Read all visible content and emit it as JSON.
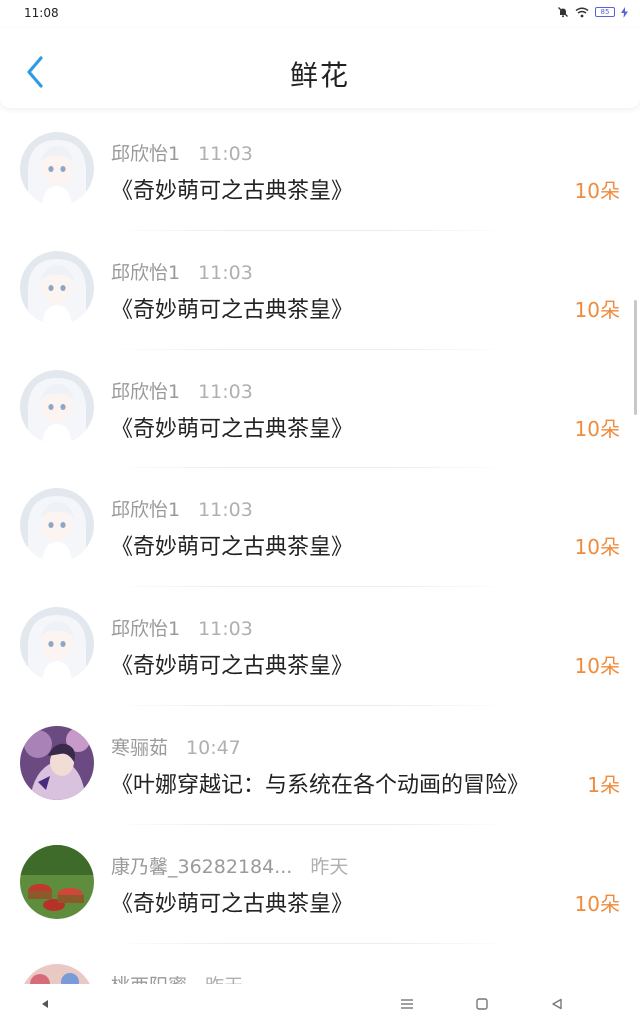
{
  "status_bar": {
    "time": "11:08",
    "battery": "85"
  },
  "header": {
    "title": "鲜花"
  },
  "colors": {
    "accent_blue": "#2f9ae6",
    "flower_amount": "#f08a3c"
  },
  "list": {
    "items": [
      {
        "user": "邱欣怡1",
        "time": "11:03",
        "book": "《奇妙萌可之古典茶皇》",
        "amount": "10朵",
        "avatar": "white-hair-girl-avatar"
      },
      {
        "user": "邱欣怡1",
        "time": "11:03",
        "book": "《奇妙萌可之古典茶皇》",
        "amount": "10朵",
        "avatar": "white-hair-girl-avatar"
      },
      {
        "user": "邱欣怡1",
        "time": "11:03",
        "book": "《奇妙萌可之古典茶皇》",
        "amount": "10朵",
        "avatar": "white-hair-girl-avatar"
      },
      {
        "user": "邱欣怡1",
        "time": "11:03",
        "book": "《奇妙萌可之古典茶皇》",
        "amount": "10朵",
        "avatar": "white-hair-girl-avatar"
      },
      {
        "user": "邱欣怡1",
        "time": "11:03",
        "book": "《奇妙萌可之古典茶皇》",
        "amount": "10朵",
        "avatar": "white-hair-girl-avatar"
      },
      {
        "user": "寒骊茹",
        "time": "10:47",
        "book": "《叶娜穿越记：与系统在各个动画的冒险》",
        "amount": "1朵",
        "avatar": "purple-anime-girl-avatar"
      },
      {
        "user": "康乃馨_36282184...",
        "time": "昨天",
        "book": "《奇妙萌可之古典茶皇》",
        "amount": "10朵",
        "avatar": "apple-baskets-avatar"
      },
      {
        "user": "桃西阳蜜",
        "time": "昨天",
        "book": "",
        "amount": "",
        "avatar": "colorful-avatar"
      }
    ]
  },
  "nav_bar": {
    "icons": [
      "back-triangle-icon",
      "menu-icon",
      "home-square-icon",
      "recent-triangle-icon"
    ]
  }
}
